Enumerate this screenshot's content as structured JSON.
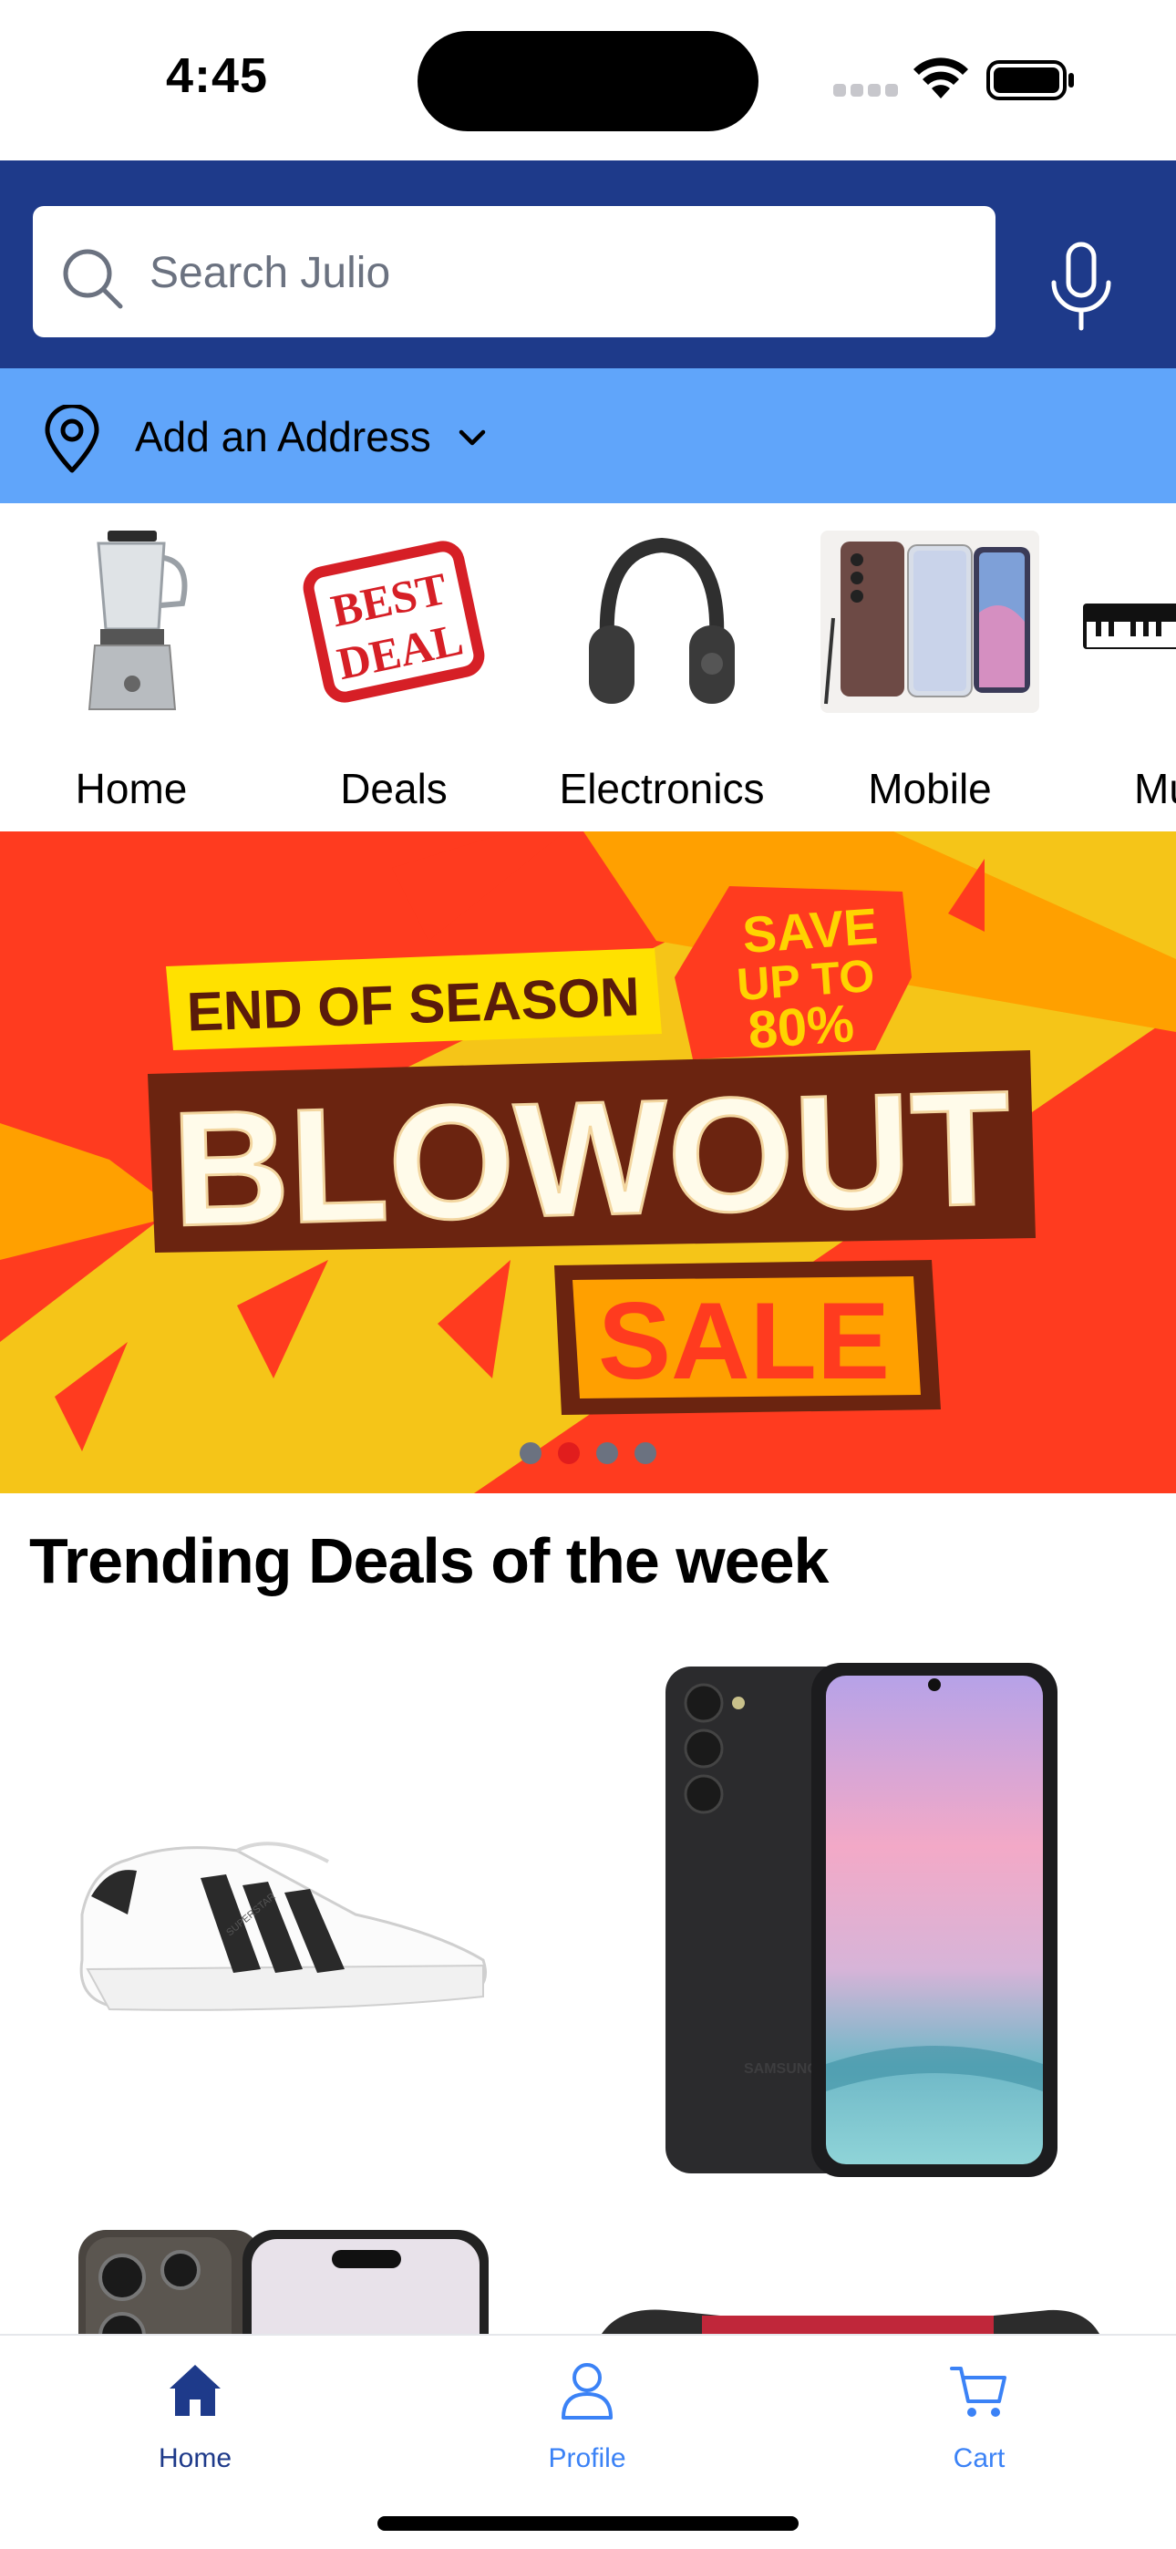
{
  "status_bar": {
    "time": "4:45"
  },
  "search": {
    "placeholder": "Search Julio",
    "value": ""
  },
  "address": {
    "label": "Add an Address"
  },
  "categories": [
    {
      "label": "Home",
      "icon": "blender-image"
    },
    {
      "label": "Deals",
      "icon": "best-deal-image"
    },
    {
      "label": "Electronics",
      "icon": "headphones-image"
    },
    {
      "label": "Mobile",
      "icon": "smartphones-image"
    },
    {
      "label": "Mu",
      "icon": "keyboard-piano-image"
    }
  ],
  "banner": {
    "top_tag": "END OF SEASON",
    "headline": "BLOWOUT",
    "subline": "SALE",
    "badge_line1": "SAVE",
    "badge_line2": "UP TO",
    "badge_line3": "80%",
    "pages": 4,
    "active_page": 2
  },
  "trending": {
    "title": "Trending Deals of the week",
    "products": [
      {
        "name": "white sneaker with black stripes",
        "icon": "sneaker-image",
        "print": "SUPERSTAR"
      },
      {
        "name": "black android smartphone",
        "icon": "phone-image",
        "print": "SAMSUNG"
      },
      {
        "name": "iphone pro",
        "icon": "iphone-image"
      },
      {
        "name": "game controller",
        "icon": "controller-image"
      }
    ]
  },
  "tab_bar": {
    "tabs": [
      {
        "label": "Home",
        "icon": "home-icon",
        "active": true
      },
      {
        "label": "Profile",
        "icon": "profile-icon",
        "active": false
      },
      {
        "label": "Cart",
        "icon": "cart-icon",
        "active": false
      }
    ],
    "active_color": "#1e3a8a",
    "inactive_color": "#3b82f6"
  },
  "colors": {
    "header": "#1e3a8a",
    "address_bar": "#60a5fa",
    "banner_red": "#ff3b1f",
    "banner_yellow": "#f5c518"
  }
}
